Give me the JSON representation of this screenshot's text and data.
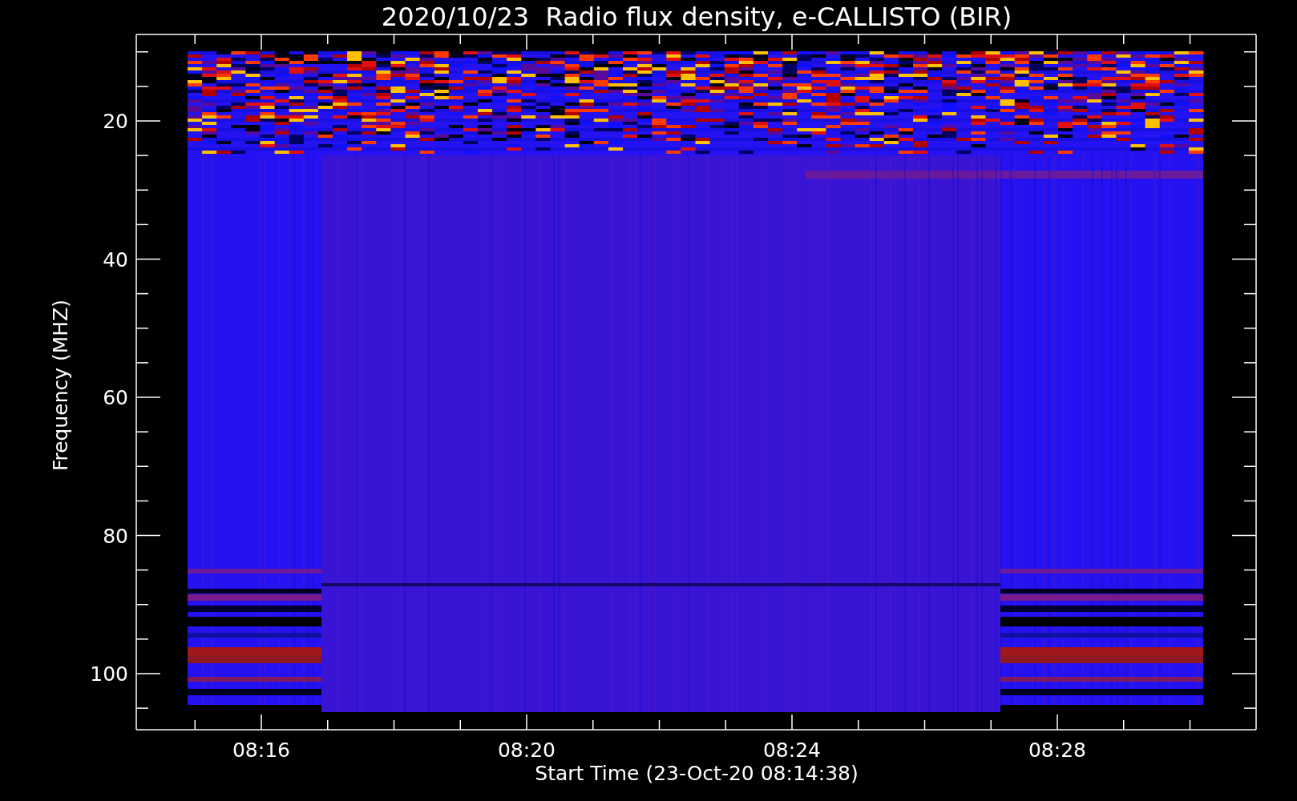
{
  "title": "2020/10/23  Radio flux density, e-CALLISTO (BIR)",
  "y_axis": {
    "label": "Frequency (MHZ)",
    "ticks": [
      "20",
      "40",
      "60",
      "80",
      "100"
    ]
  },
  "x_axis": {
    "label": "Start Time (23-Oct-20 08:14:38)",
    "ticks": [
      "08:16",
      "08:20",
      "08:24",
      "08:28"
    ]
  }
}
